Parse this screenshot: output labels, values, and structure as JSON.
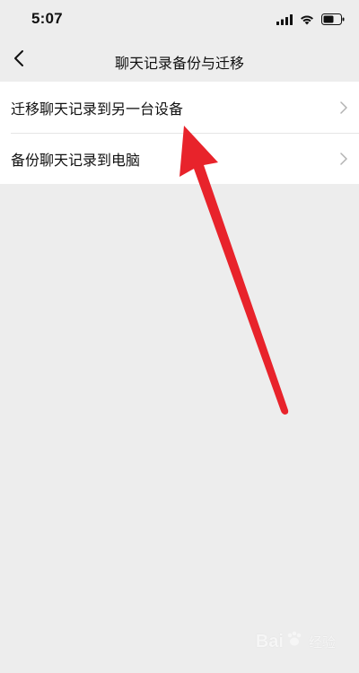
{
  "status_bar": {
    "time": "5:07",
    "icons": [
      "signal-icon",
      "wifi-icon",
      "battery-icon"
    ]
  },
  "nav": {
    "title": "聊天记录备份与迁移",
    "back_icon": "chevron-left-icon"
  },
  "menu": {
    "items": [
      {
        "label": "迁移聊天记录到另一台设备",
        "icon": "chevron-right-icon"
      },
      {
        "label": "备份聊天记录到电脑",
        "icon": "chevron-right-icon"
      }
    ]
  },
  "annotation": {
    "color": "#e8232b"
  },
  "watermark": {
    "brand": "Bai",
    "sub": "经验"
  }
}
